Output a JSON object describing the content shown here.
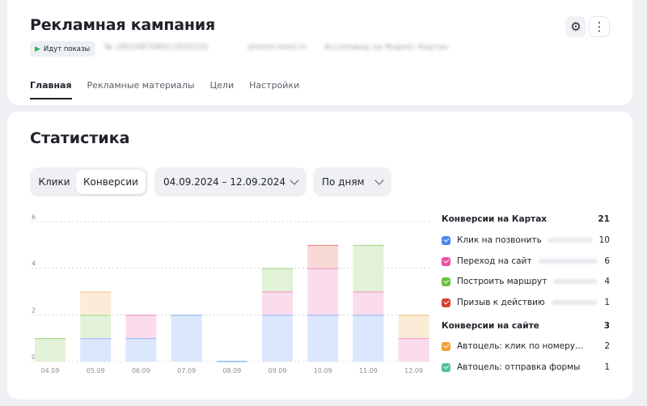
{
  "header": {
    "title": "Рекламная кампания",
    "status_badge": "Идут показы",
    "campaign_id": "№ 185248708911933120",
    "site": "promo-med.ru",
    "placement": "Ассоповод на Яндекс Картах"
  },
  "tabs": [
    {
      "label": "Главная",
      "active": true
    },
    {
      "label": "Рекламные материалы",
      "active": false
    },
    {
      "label": "Цели",
      "active": false
    },
    {
      "label": "Настройки",
      "active": false
    }
  ],
  "icons": {
    "settings": "gear-icon",
    "more": "more-vertical-icon",
    "status": "play-icon"
  },
  "stats": {
    "title": "Статистика",
    "metric_toggle": {
      "clicks": "Клики",
      "conversions": "Конверсии",
      "selected": "conversions"
    },
    "date_range": "04.09.2024 – 12.09.2024",
    "granularity": "По дням"
  },
  "legend": {
    "groups": [
      {
        "label": "Конверсии на Картах",
        "total": "21",
        "items": [
          {
            "label": "Клик на позвонить",
            "count": "10",
            "color": "#4a86f0"
          },
          {
            "label": "Переход на сайт",
            "count": "6",
            "color": "#ea4fa0"
          },
          {
            "label": "Построить маршрут",
            "count": "4",
            "color": "#6cbf3c"
          },
          {
            "label": "Призыв к действию",
            "count": "1",
            "color": "#d7412e"
          }
        ]
      },
      {
        "label": "Конверсии на сайте",
        "total": "3",
        "items": [
          {
            "label": "Автоцель: клик по номеру...",
            "count": "2",
            "color": "#f0a036"
          },
          {
            "label": "Автоцель: отправка формы",
            "count": "1",
            "color": "#4fc0a0"
          }
        ]
      }
    ]
  },
  "chart_data": {
    "type": "bar",
    "stacked": true,
    "categories": [
      "04.09",
      "05.09",
      "06.09",
      "07.09",
      "08.09",
      "09.09",
      "10.09",
      "11.09",
      "12.09"
    ],
    "series": [
      {
        "name": "Клик на позвонить",
        "color": "#4a86f0",
        "values": [
          0,
          1,
          1,
          2,
          0,
          2,
          2,
          2,
          0
        ]
      },
      {
        "name": "Переход на сайт",
        "color": "#ea4fa0",
        "values": [
          0,
          0,
          1,
          0,
          0,
          1,
          2,
          1,
          1
        ]
      },
      {
        "name": "Построить маршрут",
        "color": "#6cbf3c",
        "values": [
          1,
          1,
          0,
          0,
          0,
          1,
          0,
          2,
          0
        ]
      },
      {
        "name": "Призыв к действию",
        "color": "#d7412e",
        "values": [
          0,
          0,
          0,
          0,
          0,
          0,
          1,
          0,
          0
        ]
      },
      {
        "name": "Автоцель: клик по номеру...",
        "color": "#f0a036",
        "values": [
          0,
          1,
          0,
          0,
          0,
          0,
          0,
          0,
          1
        ]
      },
      {
        "name": "Автоцель: отправка формы",
        "color": "#4fc0a0",
        "values": [
          0,
          0,
          0,
          0,
          0,
          0,
          0,
          0,
          0
        ]
      }
    ],
    "y_ticks": [
      0,
      2,
      4,
      6
    ],
    "ylim": [
      0,
      6
    ],
    "grid": true
  }
}
